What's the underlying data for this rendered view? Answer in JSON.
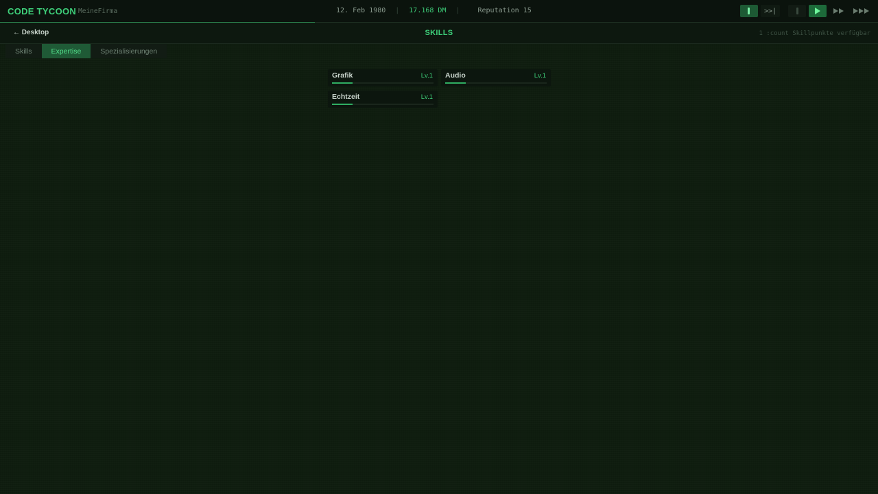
{
  "topbar": {
    "brand": "CODE TYCOON",
    "company": "MeineFirma",
    "date": "12. Feb 1980",
    "money": "17.168 DM",
    "reputation": "Reputation 15",
    "separator": "|",
    "skip_label": ">>|",
    "speed_controls": [
      "pause",
      "skip-to-event",
      "stop",
      "play",
      "fast-forward",
      "fastest-forward"
    ],
    "active_speed": "play"
  },
  "subheader": {
    "back_label": "← Desktop",
    "title": "SKILLS",
    "skillpoints": "1 :count Skillpunkte verfügbar"
  },
  "tabs": [
    {
      "label": "Skills",
      "active": false
    },
    {
      "label": "Expertise",
      "active": true
    },
    {
      "label": "Spezialisierungen",
      "active": false
    }
  ],
  "skills": [
    {
      "name": "Grafik",
      "level": "Lv.1",
      "progress": 0.2
    },
    {
      "name": "Audio",
      "level": "Lv.1",
      "progress": 0.2
    },
    {
      "name": "Echtzeit",
      "level": "Lv.1",
      "progress": 0.2
    }
  ],
  "colors": {
    "accent": "#3ed07a",
    "background": "#0f1d0f",
    "active_tab": "#1f5a36"
  }
}
